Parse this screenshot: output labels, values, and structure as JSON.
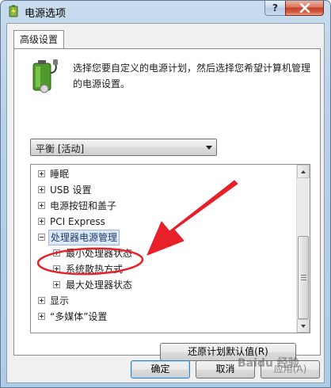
{
  "window": {
    "title": "电源选项",
    "help_label": "?",
    "close_icon": "close-icon"
  },
  "tab": {
    "label": "高级设置"
  },
  "description": "选择您要自定义的电源计划，然后选择您希望计算机管理的电源设置。",
  "plan_select": {
    "value": "平衡 [活动]"
  },
  "tree": {
    "items": [
      {
        "label": "睡眠",
        "expander": "plus"
      },
      {
        "label": "USB 设置",
        "expander": "plus"
      },
      {
        "label": "电源按钮和盖子",
        "expander": "plus"
      },
      {
        "label": "PCI Express",
        "expander": "plus"
      },
      {
        "label": "处理器电源管理",
        "expander": "minus"
      },
      {
        "label": "最小处理器状态",
        "expander": "plus"
      },
      {
        "label": "系统散热方式",
        "expander": "plus"
      },
      {
        "label": "最大处理器状态",
        "expander": "plus"
      },
      {
        "label": "显示",
        "expander": "plus"
      },
      {
        "label": "“多媒体”设置",
        "expander": "plus"
      }
    ]
  },
  "buttons": {
    "restore_label": "还原计划默认值(R)",
    "ok_label": "确定",
    "cancel_label": "取消",
    "apply_label": "应用(A)"
  },
  "annotation": {
    "color": "#e8202a",
    "watermark": "Baidu 经验"
  }
}
